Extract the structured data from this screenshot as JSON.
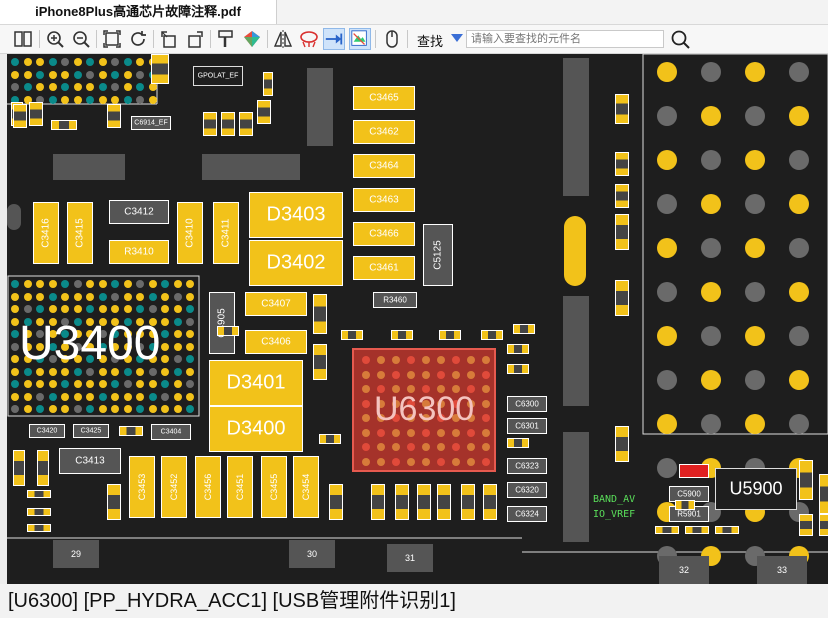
{
  "tab": {
    "title": "iPhone8Plus高通芯片故障注释.pdf"
  },
  "toolbar": {
    "find_label": "查找",
    "search_placeholder": "请输入要查找的元件名",
    "icons": [
      "split-view-icon",
      "zoom-in-icon",
      "zoom-out-icon",
      "fit-page-icon",
      "refresh-icon",
      "rotate-left-icon",
      "rotate-right-icon",
      "paint-icon",
      "color-icon",
      "mirror-icon",
      "net-highlight-icon",
      "arrow-icon",
      "select-icon",
      "hand-icon",
      "search-icon"
    ]
  },
  "board": {
    "labels": {
      "u3400": "U3400",
      "u6300": "U6300",
      "d3401": "D3401",
      "d3400": "D3400",
      "d3403": "D3403",
      "d3402": "D3402",
      "u5900": "U5900",
      "c3465": "C3465",
      "c3462": "C3462",
      "c3464": "C3464",
      "c3463": "C3463",
      "c3466": "C3466",
      "c3461": "C3461",
      "c3407": "C3407",
      "c3406": "C3406",
      "c3412": "C3412",
      "r3410": "R3410",
      "c3413": "C3413",
      "c3416": "C3416",
      "c3415": "C3415",
      "c3410": "C3410",
      "c3411": "C3411",
      "c4905": "C4905",
      "c5125": "C5125",
      "r3460": "R3460",
      "c6300": "C6300",
      "c6301": "C6301",
      "c6323": "C6323",
      "c6320": "C6320",
      "c6324": "C6324",
      "c5900": "C5900",
      "r5901": "R5901",
      "c6914": "C6914_EF",
      "gpolat": "GPOLAT_EF",
      "c3453": "C3453",
      "c3452": "C3452",
      "c3456": "C3456",
      "c3451": "C3451",
      "c3455": "C3455",
      "c3454": "C3454",
      "c3420": "C3420",
      "c3425": "C3425",
      "c3404": "C3404",
      "band": "BAND_AV",
      "io_vref": "IO_VREF",
      "n29": "29",
      "n30": "30",
      "n31": "31",
      "n32": "32",
      "n33": "33"
    }
  },
  "status": {
    "text": "[U6300] [PP_HYDRA_ACC1] [USB管理附件识别1]"
  },
  "colors": {
    "pad_yellow": "#f2c21a",
    "board_bg": "#1e1e1e",
    "highlight_red": "#c0392b",
    "teal": "#0a8a8a"
  }
}
